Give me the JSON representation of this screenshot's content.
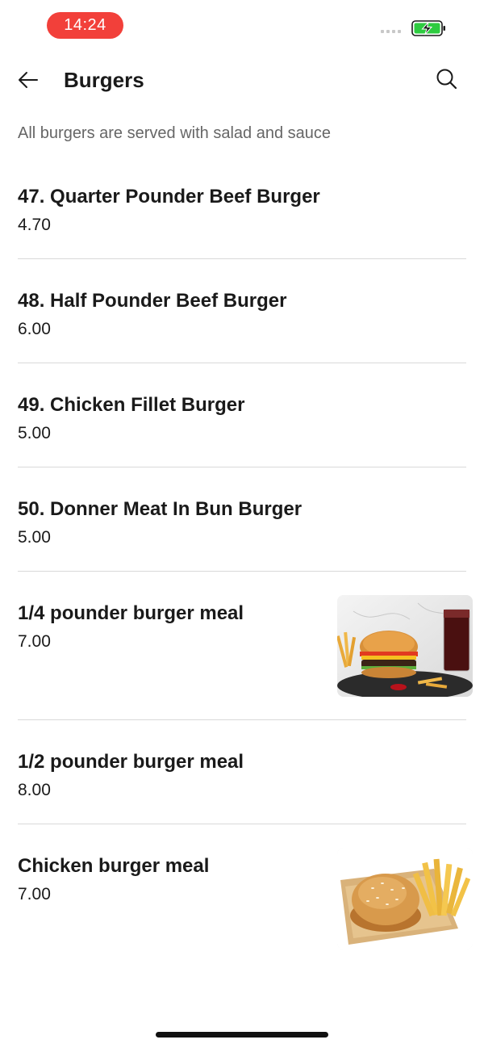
{
  "status_bar": {
    "time": "14:24",
    "battery_color": "#2ecc40",
    "time_pill_color": "#f2403a"
  },
  "header": {
    "title": "Burgers",
    "back_icon": "arrow-left-icon",
    "search_icon": "search-icon"
  },
  "category": {
    "description": "All burgers are served with salad and sauce"
  },
  "items": [
    {
      "name": "47. Quarter Pounder Beef Burger",
      "price": "4.70",
      "has_image": false
    },
    {
      "name": "48. Half Pounder Beef Burger",
      "price": "6.00",
      "has_image": false
    },
    {
      "name": "49. Chicken Fillet Burger",
      "price": "5.00",
      "has_image": false
    },
    {
      "name": "50. Donner Meat In Bun Burger",
      "price": "5.00",
      "has_image": false
    },
    {
      "name": "1/4 pounder burger meal",
      "price": "7.00",
      "has_image": true,
      "image": "burger-meal-photo"
    },
    {
      "name": "1/2 pounder burger meal",
      "price": "8.00",
      "has_image": false
    },
    {
      "name": "Chicken burger meal",
      "price": "7.00",
      "has_image": true,
      "image": "chicken-burger-fries-photo"
    }
  ]
}
